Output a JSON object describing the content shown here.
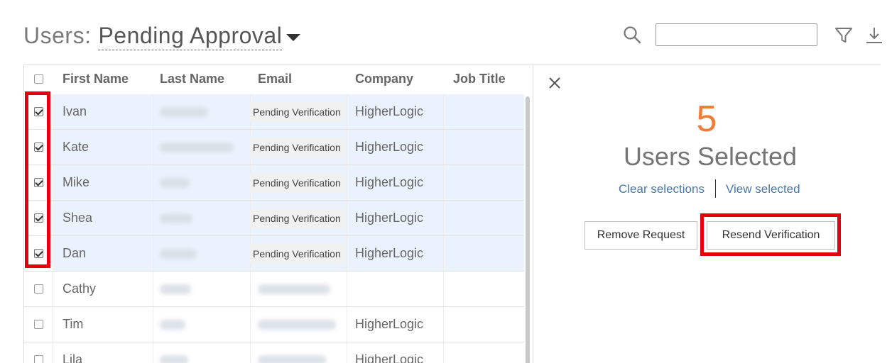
{
  "header": {
    "title_prefix": "Users:",
    "view_label": "Pending Approval",
    "search_value": ""
  },
  "grid": {
    "columns": [
      "First Name",
      "Last Name",
      "Email",
      "Company",
      "Job Title"
    ],
    "rows": [
      {
        "first": "Ivan",
        "email_status": "Pending Verification",
        "company": "HigherLogic",
        "checked": true
      },
      {
        "first": "Kate",
        "email_status": "Pending Verification",
        "company": "HigherLogic",
        "checked": true
      },
      {
        "first": "Mike",
        "email_status": "Pending Verification",
        "company": "HigherLogic",
        "checked": true
      },
      {
        "first": "Shea",
        "email_status": "Pending Verification",
        "company": "HigherLogic",
        "checked": true
      },
      {
        "first": "Dan",
        "email_status": "Pending Verification",
        "company": "HigherLogic",
        "checked": true
      },
      {
        "first": "Cathy",
        "email_status": "",
        "company": "",
        "checked": false
      },
      {
        "first": "Tim",
        "email_status": "",
        "company": "HigherLogic",
        "checked": false
      },
      {
        "first": "Lila",
        "email_status": "",
        "company": "HigherLogic",
        "checked": false
      }
    ]
  },
  "panel": {
    "count": "5",
    "count_label": "Users Selected",
    "clear_label": "Clear selections",
    "view_label": "View selected",
    "remove_label": "Remove Request",
    "resend_label": "Resend Verification"
  },
  "colors": {
    "accent_orange": "#ee7d3a",
    "link_blue": "#4a78a8",
    "highlight_red": "#e3000f",
    "row_selected": "#eaf3fd"
  }
}
